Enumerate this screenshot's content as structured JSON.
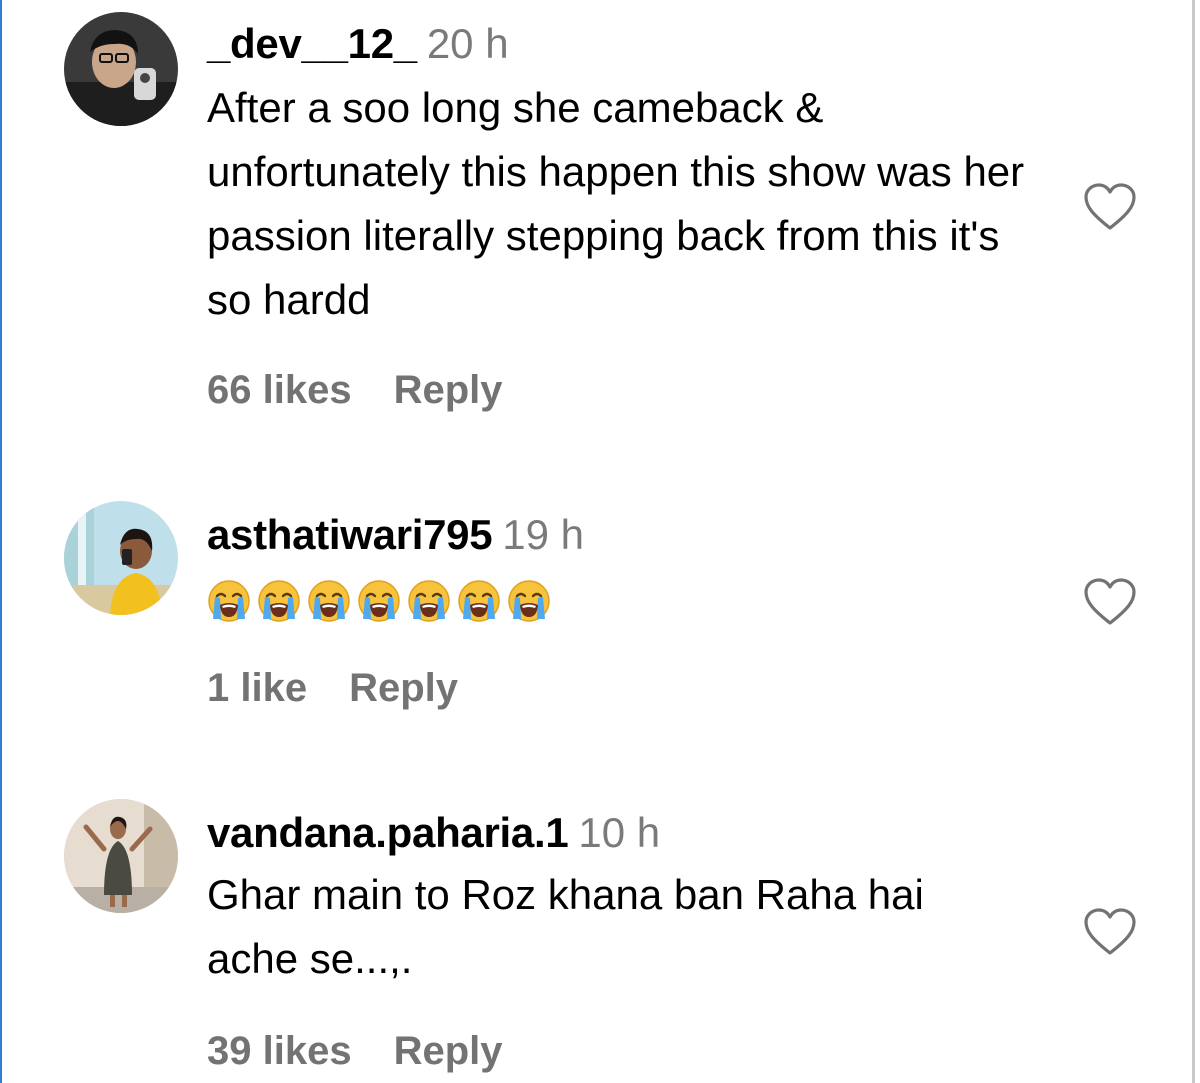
{
  "comments": [
    {
      "username": "_dev__12_",
      "time": "20 h",
      "text": "After a soo long she cameback & unfortunately this happen this show was her passion literally stepping back from this it's so hardd",
      "likes": "66 likes",
      "reply": "Reply"
    },
    {
      "username": "asthatiwari795",
      "time": "19 h",
      "text": "😭😭😭😭😭😭😭",
      "likes": "1 like",
      "reply": "Reply"
    },
    {
      "username": "vandana.paharia.1",
      "time": "10 h",
      "text": "Ghar main to Roz khana ban Raha hai ache se...,.",
      "likes": "39 likes",
      "reply": "Reply"
    }
  ],
  "icons": {
    "like": "heart-outline-icon",
    "emoji": "loudly-crying-face"
  },
  "colors": {
    "text": "#000000",
    "secondary": "#737373",
    "frame_accent": "#2f7fd6"
  }
}
